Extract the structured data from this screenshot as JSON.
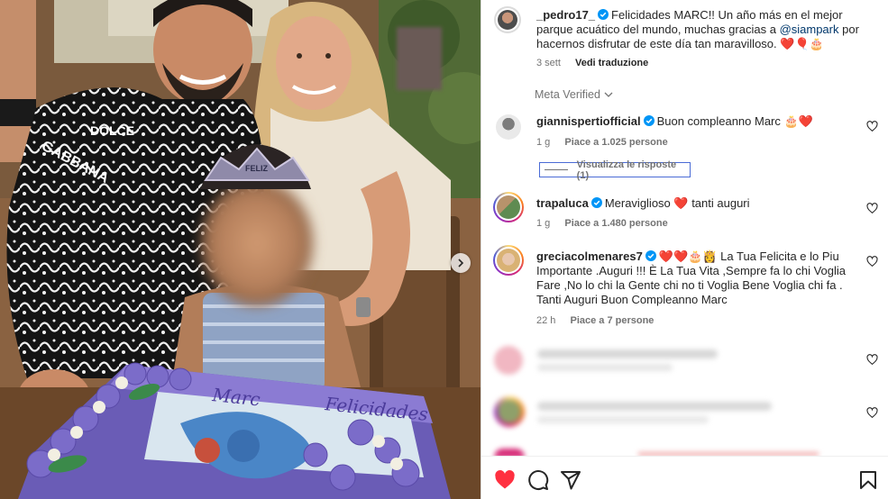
{
  "post": {
    "author": "_pedro17_",
    "caption": "Felicidades MARC!! Un año más en el mejor parque acuático del mundo, muchas gracias a",
    "caption_mention": "@siampark",
    "caption_end": "por hacernos disfrutar de este día tan maravilloso. ❤️🎈🎂",
    "time": "3 sett",
    "translate_label": "Vedi traduzione",
    "photo_text": {
      "shirt_text_1": "GABBANA",
      "shirt_text_2": "DOLCE",
      "crown_text": "FELIZ",
      "cake_text_1": "Felicidades",
      "cake_text_2": "Marc"
    }
  },
  "meta_verified_label": "Meta Verified",
  "comments": [
    {
      "user": "giannispertiofficial",
      "text": "Buon compleanno Marc 🎂❤️",
      "time": "1 g",
      "likes": "Piace a 1.025 persone",
      "replies_label": "Visualizza le risposte (1)"
    },
    {
      "user": "trapaluca",
      "text": "Meraviglioso ❤️ tanti auguri",
      "time": "1 g",
      "likes": "Piace a 1.480 persone"
    },
    {
      "user": "greciacolmenares7",
      "text": "❤️❤️🎂👸 La Tua Felicita e lo Piu Importante .Auguri !!! È La Tua Vita ,Sempre fa lo chi Voglia Fare ,No lo chi la Gente chi no ti Voglia Bene Voglia chi fa . Tanti Auguri Buon Compleanno Marc",
      "time": "22 h",
      "likes": "Piace a 7 persone"
    }
  ],
  "colors": {
    "verified": "#0095f6",
    "liked_heart": "#ff3040",
    "mention": "#00376b",
    "secondary_text": "#737373"
  },
  "icons": {
    "like": "heart-filled-icon",
    "comment": "comment-bubble-icon",
    "share": "paper-plane-icon",
    "save": "bookmark-icon",
    "next": "chevron-right-icon"
  }
}
